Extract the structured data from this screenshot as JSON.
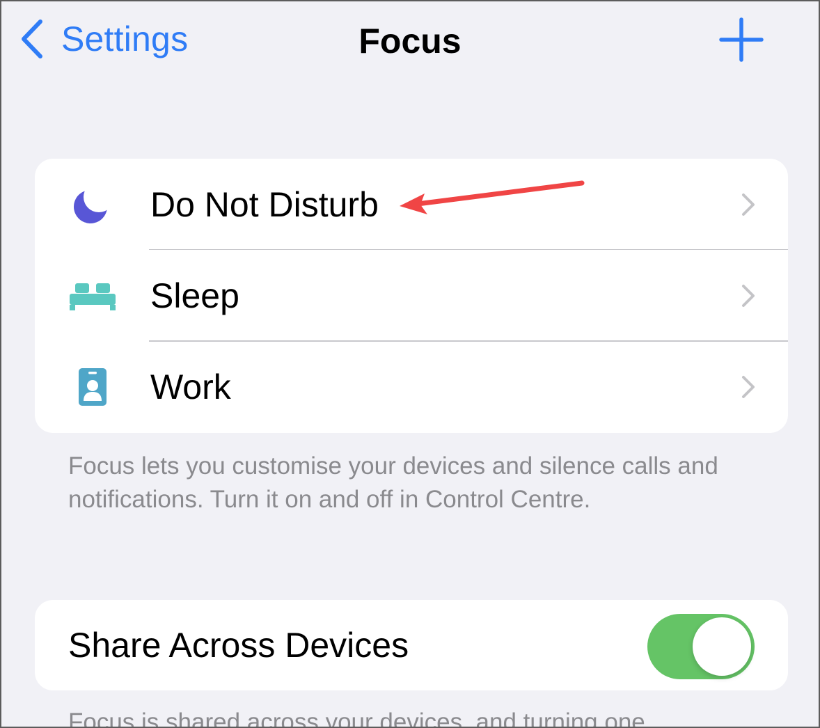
{
  "nav": {
    "back_label": "Settings",
    "title": "Focus",
    "add_icon": "plus-icon",
    "accent_color": "#2f7cf6"
  },
  "focus_modes": [
    {
      "label": "Do Not Disturb",
      "icon": "moon-icon",
      "icon_color": "#5856d6"
    },
    {
      "label": "Sleep",
      "icon": "bed-icon",
      "icon_color": "#5ac8c0"
    },
    {
      "label": "Work",
      "icon": "id-badge-icon",
      "icon_color": "#4fa6c8"
    }
  ],
  "focus_footnote": "Focus lets you customise your devices and silence calls and notifications. Turn it on and off in Control Centre.",
  "share": {
    "label": "Share Across Devices",
    "enabled": true,
    "toggle_color": "#65c466"
  },
  "share_footnote": "Focus is shared across your devices, and turning one",
  "annotation": {
    "color": "#f04545",
    "target": "Do Not Disturb"
  }
}
